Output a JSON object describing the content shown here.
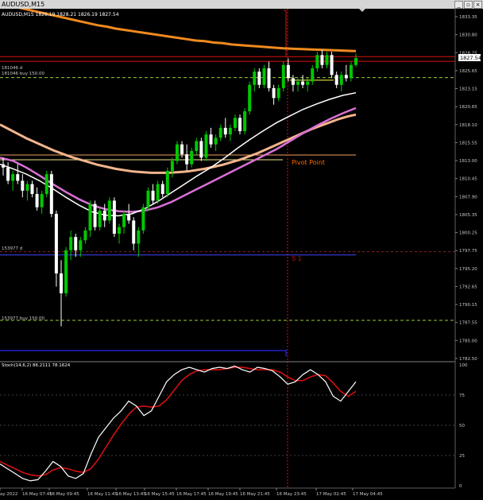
{
  "window": {
    "title": "AUDUSD,M15",
    "minimize_glyph": "_",
    "restore_glyph": "▫",
    "close_glyph": "×"
  },
  "info": {
    "symbol_line": "AUDUSD,M15  1826.19 1828.21 1826.19 1827.54",
    "order1_id": "181046 d",
    "order1_label": "181046 buy 150.00",
    "order2_id": "153977 d",
    "order2_label": "153977 buy 150.00",
    "pivot_label": "Pivot Point",
    "s1_label": "S 1",
    "current_price": "1827.54"
  },
  "price_axis": {
    "labels": [
      "1833.35",
      "1830.80",
      "1828.25",
      "1825.65",
      "1823.15",
      "1820.65",
      "1818.10",
      "1815.55",
      "1813.00",
      "1810.45",
      "1807.90",
      "1805.35",
      "1800.25",
      "1797.75",
      "1795.20",
      "1792.65",
      "1790.15",
      "1787.55",
      "1785.00",
      "1782.50"
    ]
  },
  "indicator": {
    "header": "Stoch(14,6,2) 86.2111 78.1624",
    "levels": [
      "100",
      "75",
      "50",
      "25",
      "0"
    ]
  },
  "time_axis": {
    "labels": [
      "ay 2022",
      "16 May 07:45",
      "16 May 09:45",
      "16 May 11:45",
      "16 May 13:45",
      "16 May 15:45",
      "16 May 17:45",
      "16 May 19:45",
      "16 May 21:45",
      "16 May 23:45",
      "17 May 02:45",
      "17 May 04:45"
    ]
  },
  "colors": {
    "background": "#000000",
    "bull": "#00c800",
    "bear": "#ffffff",
    "ma_orange": "#f08a1e",
    "ma_salmon": "#f2b48c",
    "ma_violet": "#da70d6",
    "ma_white": "#ffffff",
    "pivot": "#f0a060",
    "support": "#3030b0",
    "order": "#9acd32",
    "stoch_main": "#ffffff",
    "stoch_signal": "#e01010"
  },
  "chart_data": {
    "type": "candlestick",
    "series_colors_note": "",
    "ylim": [
      1782.5,
      1835.0
    ],
    "levels": {
      "pivot": 1812.9,
      "s1": 1797.8,
      "order_181046": 1824.6,
      "order_153977": 1787.9,
      "current": 1827.54,
      "horizontal_red": 1828.0
    },
    "candles": [
      [
        1811.5,
        1812.5,
        1809.8,
        1811.0
      ],
      [
        1811.0,
        1811.8,
        1808.5,
        1809.0
      ],
      [
        1809.0,
        1810.5,
        1807.5,
        1810.0
      ],
      [
        1810.0,
        1811.5,
        1808.5,
        1809.0
      ],
      [
        1809.0,
        1810.0,
        1806.5,
        1807.5
      ],
      [
        1807.5,
        1809.0,
        1806.0,
        1808.5
      ],
      [
        1808.5,
        1809.0,
        1806.5,
        1807.0
      ],
      [
        1807.0,
        1808.0,
        1804.5,
        1805.0
      ],
      [
        1805.0,
        1807.5,
        1804.0,
        1807.0
      ],
      [
        1807.0,
        1810.5,
        1806.5,
        1810.0
      ],
      [
        1810.0,
        1810.5,
        1803.5,
        1804.0
      ],
      [
        1804.0,
        1804.5,
        1793.0,
        1795.0
      ],
      [
        1795.0,
        1797.0,
        1787.0,
        1792.0
      ],
      [
        1792.0,
        1799.0,
        1791.5,
        1798.5
      ],
      [
        1798.5,
        1801.5,
        1797.0,
        1800.5
      ],
      [
        1800.5,
        1801.0,
        1797.5,
        1798.5
      ],
      [
        1798.5,
        1800.5,
        1797.5,
        1800.0
      ],
      [
        1800.0,
        1802.0,
        1799.5,
        1801.5
      ],
      [
        1801.5,
        1806.0,
        1800.5,
        1805.5
      ],
      [
        1805.5,
        1806.0,
        1801.5,
        1802.0
      ],
      [
        1802.0,
        1805.0,
        1801.5,
        1804.5
      ],
      [
        1804.5,
        1805.5,
        1802.0,
        1803.0
      ],
      [
        1803.0,
        1806.5,
        1802.5,
        1806.0
      ],
      [
        1806.0,
        1806.5,
        1800.5,
        1801.0
      ],
      [
        1801.0,
        1802.5,
        1799.5,
        1802.0
      ],
      [
        1802.0,
        1804.5,
        1801.0,
        1804.0
      ],
      [
        1804.0,
        1805.5,
        1802.5,
        1803.0
      ],
      [
        1803.0,
        1803.5,
        1798.5,
        1799.5
      ],
      [
        1799.5,
        1802.0,
        1797.5,
        1801.5
      ],
      [
        1801.5,
        1805.5,
        1801.0,
        1805.0
      ],
      [
        1805.0,
        1808.0,
        1804.5,
        1807.5
      ],
      [
        1807.5,
        1808.5,
        1805.5,
        1806.0
      ],
      [
        1806.0,
        1809.0,
        1805.5,
        1808.5
      ],
      [
        1808.5,
        1809.0,
        1806.5,
        1807.0
      ],
      [
        1807.0,
        1811.0,
        1806.5,
        1810.5
      ],
      [
        1810.5,
        1812.5,
        1809.5,
        1812.0
      ],
      [
        1812.0,
        1815.0,
        1811.5,
        1814.5
      ],
      [
        1814.5,
        1815.0,
        1812.5,
        1813.0
      ],
      [
        1813.0,
        1814.5,
        1810.5,
        1811.5
      ],
      [
        1811.5,
        1814.0,
        1811.0,
        1813.5
      ],
      [
        1813.5,
        1815.5,
        1813.0,
        1815.0
      ],
      [
        1815.0,
        1815.5,
        1812.0,
        1812.5
      ],
      [
        1812.5,
        1816.5,
        1812.0,
        1816.0
      ],
      [
        1816.0,
        1817.0,
        1814.0,
        1814.5
      ],
      [
        1814.5,
        1816.0,
        1813.5,
        1815.5
      ],
      [
        1815.5,
        1817.5,
        1815.0,
        1817.0
      ],
      [
        1817.0,
        1818.5,
        1815.5,
        1816.0
      ],
      [
        1816.0,
        1817.5,
        1815.0,
        1817.0
      ],
      [
        1817.0,
        1819.0,
        1816.5,
        1818.5
      ],
      [
        1818.5,
        1819.0,
        1816.0,
        1816.5
      ],
      [
        1816.5,
        1820.0,
        1816.0,
        1819.5
      ],
      [
        1819.5,
        1824.0,
        1819.0,
        1823.5
      ],
      [
        1823.5,
        1826.0,
        1822.5,
        1825.5
      ],
      [
        1825.5,
        1826.0,
        1823.0,
        1823.5
      ],
      [
        1823.5,
        1826.5,
        1823.0,
        1826.0
      ],
      [
        1826.0,
        1827.0,
        1822.5,
        1823.0
      ],
      [
        1823.0,
        1823.5,
        1820.5,
        1821.5
      ],
      [
        1821.5,
        1823.5,
        1821.0,
        1823.0
      ],
      [
        1823.0,
        1827.0,
        1822.5,
        1826.5
      ],
      [
        1826.5,
        1827.5,
        1824.0,
        1824.5
      ],
      [
        1824.5,
        1825.0,
        1822.5,
        1823.5
      ],
      [
        1823.5,
        1824.5,
        1822.5,
        1824.0
      ],
      [
        1824.0,
        1825.0,
        1823.0,
        1823.5
      ],
      [
        1823.5,
        1824.5,
        1822.5,
        1824.0
      ],
      [
        1824.0,
        1826.5,
        1823.5,
        1826.0
      ],
      [
        1826.0,
        1828.5,
        1825.5,
        1828.0
      ],
      [
        1828.0,
        1828.8,
        1826.0,
        1826.5
      ],
      [
        1826.5,
        1828.5,
        1826.0,
        1828.0
      ],
      [
        1828.0,
        1828.5,
        1824.5,
        1825.0
      ],
      [
        1825.0,
        1825.5,
        1823.0,
        1823.5
      ],
      [
        1823.5,
        1825.5,
        1822.5,
        1825.0
      ],
      [
        1825.0,
        1826.5,
        1824.0,
        1824.5
      ],
      [
        1824.5,
        1827.0,
        1824.0,
        1826.5
      ],
      [
        1826.5,
        1828.2,
        1826.2,
        1827.54
      ]
    ],
    "ma_orange": [
      1835.8,
      1835.5,
      1835.2,
      1834.9,
      1834.6,
      1834.3,
      1834.0,
      1833.7,
      1833.4,
      1833.1,
      1832.8,
      1832.5,
      1832.3,
      1832.0,
      1831.8,
      1831.6,
      1831.4,
      1831.2,
      1831.0,
      1830.8,
      1830.6,
      1830.4,
      1830.2,
      1830.1,
      1829.9,
      1829.8,
      1829.6,
      1829.5,
      1829.4,
      1829.3,
      1829.2,
      1829.1,
      1829.0,
      1828.95,
      1828.9,
      1828.85,
      1828.8,
      1828.75,
      1828.7,
      1828.65,
      1828.6
    ],
    "ma_salmon": [
      1817.5,
      1816.8,
      1816.1,
      1815.4,
      1814.8,
      1814.2,
      1813.6,
      1813.1,
      1812.6,
      1812.2,
      1811.8,
      1811.4,
      1811.1,
      1810.8,
      1810.6,
      1810.4,
      1810.3,
      1810.2,
      1810.2,
      1810.2,
      1810.3,
      1810.4,
      1810.6,
      1810.8,
      1811.1,
      1811.4,
      1811.8,
      1812.2,
      1812.7,
      1813.2,
      1813.8,
      1814.4,
      1815.0,
      1815.6,
      1816.2,
      1816.8,
      1817.3,
      1817.8,
      1818.3,
      1818.7,
      1819.0
    ],
    "ma_violet": [
      1812.5,
      1812.0,
      1811.0,
      1809.8,
      1808.5,
      1807.3,
      1806.2,
      1805.3,
      1804.7,
      1804.4,
      1804.3,
      1804.5,
      1805.0,
      1805.8,
      1806.8,
      1807.8,
      1808.8,
      1809.8,
      1810.8,
      1811.8,
      1812.8,
      1813.8,
      1815.0,
      1816.2,
      1817.3,
      1818.3,
      1819.2,
      1820.0
    ],
    "ma_white": [
      1811.5,
      1810.8,
      1810.0,
      1809.0,
      1807.8,
      1806.5,
      1805.3,
      1804.3,
      1803.8,
      1803.7,
      1804.0,
      1804.8,
      1805.9,
      1807.2,
      1808.5,
      1809.8,
      1811.0,
      1812.4,
      1813.9,
      1815.3,
      1816.6,
      1817.8,
      1818.8,
      1819.8,
      1820.6,
      1821.3,
      1821.9,
      1822.3
    ],
    "stoch_main": [
      18,
      14,
      10,
      6,
      4,
      5,
      12,
      20,
      16,
      8,
      6,
      10,
      26,
      40,
      48,
      56,
      62,
      70,
      66,
      58,
      62,
      74,
      86,
      92,
      96,
      98,
      96,
      94,
      97,
      98,
      97,
      99,
      96,
      94,
      98,
      97,
      95,
      90,
      84,
      86,
      92,
      96,
      92,
      86,
      74,
      70,
      78,
      86
    ],
    "stoch_signal": [
      20,
      17,
      14,
      11,
      9,
      8,
      9,
      13,
      15,
      14,
      12,
      11,
      14,
      22,
      32,
      42,
      51,
      59,
      65,
      66,
      65,
      66,
      71,
      79,
      87,
      92,
      95,
      96,
      96,
      96,
      97,
      98,
      98,
      97,
      96,
      96,
      96,
      94,
      90,
      87,
      87,
      90,
      92,
      91,
      85,
      78,
      74,
      78
    ]
  }
}
